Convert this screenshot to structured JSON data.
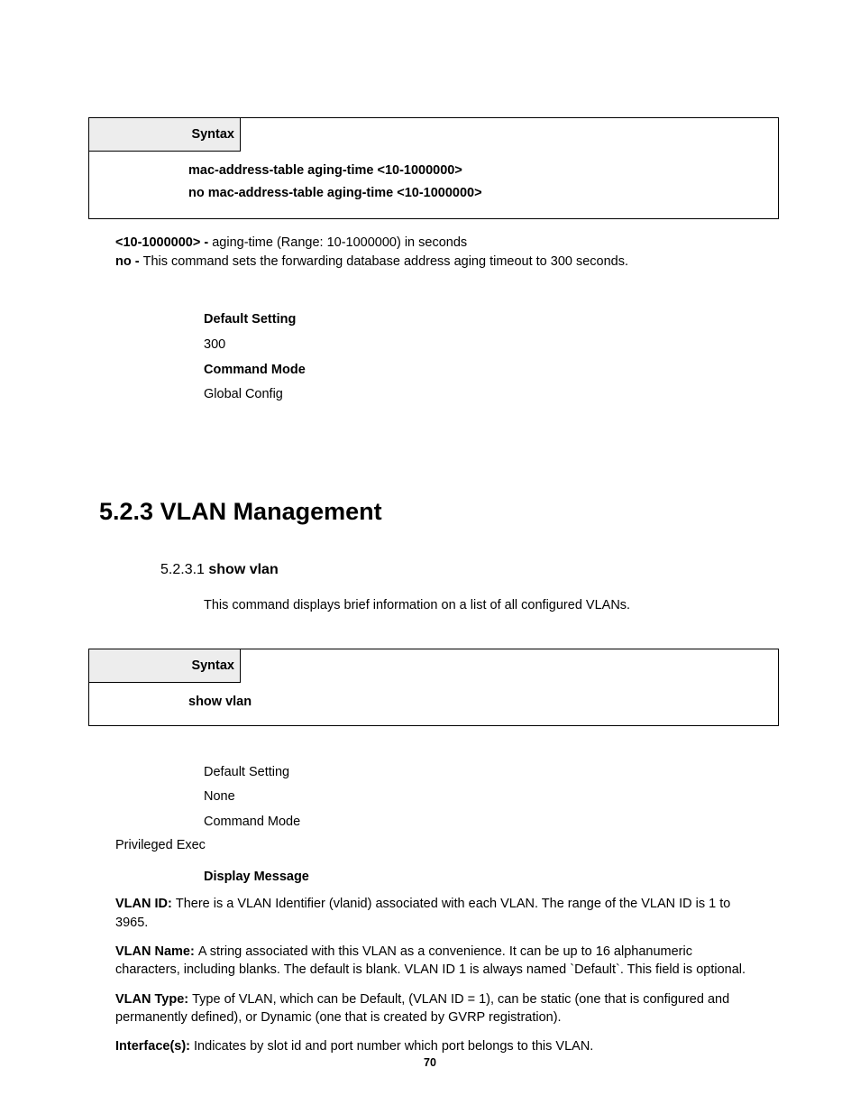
{
  "syntax1": {
    "header": "Syntax",
    "line1": "mac-address-table aging-time <10-1000000>",
    "line2": "no mac-address-table aging-time <10-1000000>"
  },
  "params1": {
    "p1_label": "<10-1000000> - ",
    "p1_text": "aging-time (Range: 10-1000000) in seconds",
    "p2_label": "no - ",
    "p2_text": "This command sets the forwarding database address aging timeout to 300 seconds."
  },
  "settings1": {
    "default_label": "Default Setting",
    "default_value": "300",
    "mode_label": "Command Mode",
    "mode_value": "Global Config"
  },
  "section": {
    "number": "5.2.3 ",
    "title": "VLAN Management"
  },
  "subsection": {
    "number": "5.2.3.1 ",
    "title": "show vlan",
    "desc": "This command displays brief information on a list of all configured VLANs."
  },
  "syntax2": {
    "header": "Syntax",
    "line1": "show vlan"
  },
  "settings2": {
    "default_label": "Default Setting",
    "default_value": "None",
    "mode_label": "Command Mode",
    "mode_value": "Privileged Exec",
    "display_label": "Display Message"
  },
  "display": {
    "d1_label": "VLAN ID: ",
    "d1_text": "There is a VLAN Identifier (vlanid) associated with each VLAN. The range of the VLAN ID is 1 to 3965.",
    "d2_label": "VLAN Name: ",
    "d2_text": "A string associated with this VLAN as a convenience. It can be up to 16 alphanumeric characters, including blanks. The default is blank. VLAN ID 1 is always named `Default`. This field is optional.",
    "d3_label": "VLAN Type: ",
    "d3_text": "Type of VLAN, which can be Default, (VLAN ID = 1), can be static (one that is configured and permanently defined), or Dynamic (one that is created by GVRP registration).",
    "d4_label": "Interface(s): ",
    "d4_text": "Indicates by slot id and port number which port belongs to this VLAN."
  },
  "page_number": "70"
}
